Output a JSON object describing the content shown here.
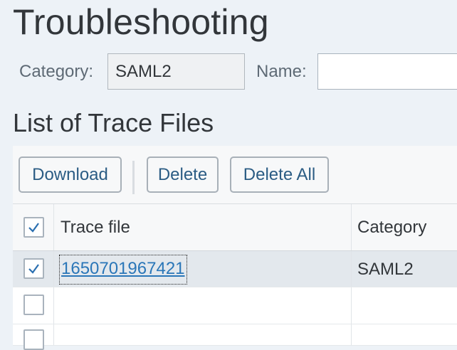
{
  "page": {
    "title": "Troubleshooting"
  },
  "filters": {
    "category_label": "Category:",
    "category_value": "SAML2",
    "name_label": "Name:",
    "name_value": ""
  },
  "section": {
    "title": "List of Trace Files"
  },
  "toolbar": {
    "download_label": "Download",
    "delete_label": "Delete",
    "delete_all_label": "Delete All"
  },
  "table": {
    "header_checkbox_checked": true,
    "columns": [
      "Trace file",
      "Category"
    ],
    "rows": [
      {
        "selected": true,
        "trace_file": "1650701967421",
        "category": "SAML2"
      },
      {
        "selected": false,
        "trace_file": "",
        "category": ""
      },
      {
        "selected": false,
        "trace_file": "",
        "category": ""
      }
    ]
  }
}
